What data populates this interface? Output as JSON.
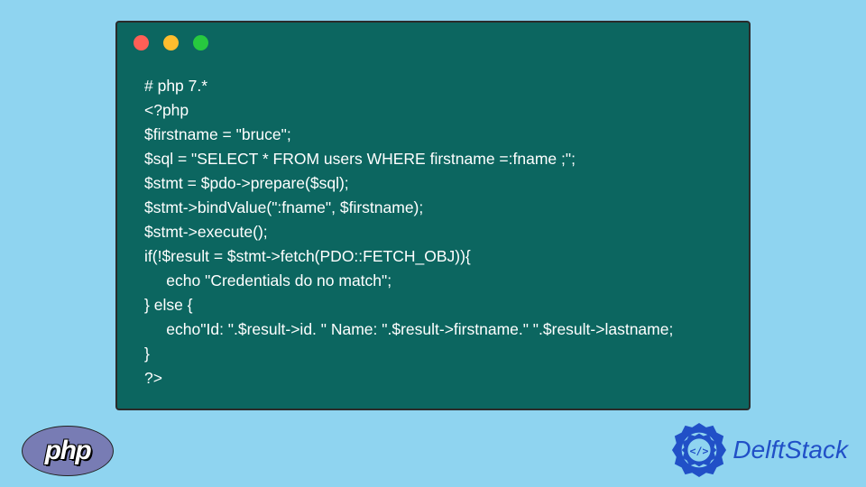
{
  "code": {
    "lines": [
      "# php 7.*",
      "<?php",
      "$firstname = \"bruce\";",
      "$sql = \"SELECT * FROM users WHERE firstname =:fname ;\";",
      "$stmt = $pdo->prepare($sql);",
      "$stmt->bindValue(\":fname\", $firstname);",
      "$stmt->execute();",
      "if(!$result = $stmt->fetch(PDO::FETCH_OBJ)){",
      "     echo \"Credentials do no match\";",
      "} else {",
      "     echo\"Id: \".$result->id. \" Name: \".$result->firstname.\" \".$result->lastname;",
      "}",
      "?>"
    ]
  },
  "logos": {
    "php": "php",
    "delftstack": "DelftStack"
  }
}
